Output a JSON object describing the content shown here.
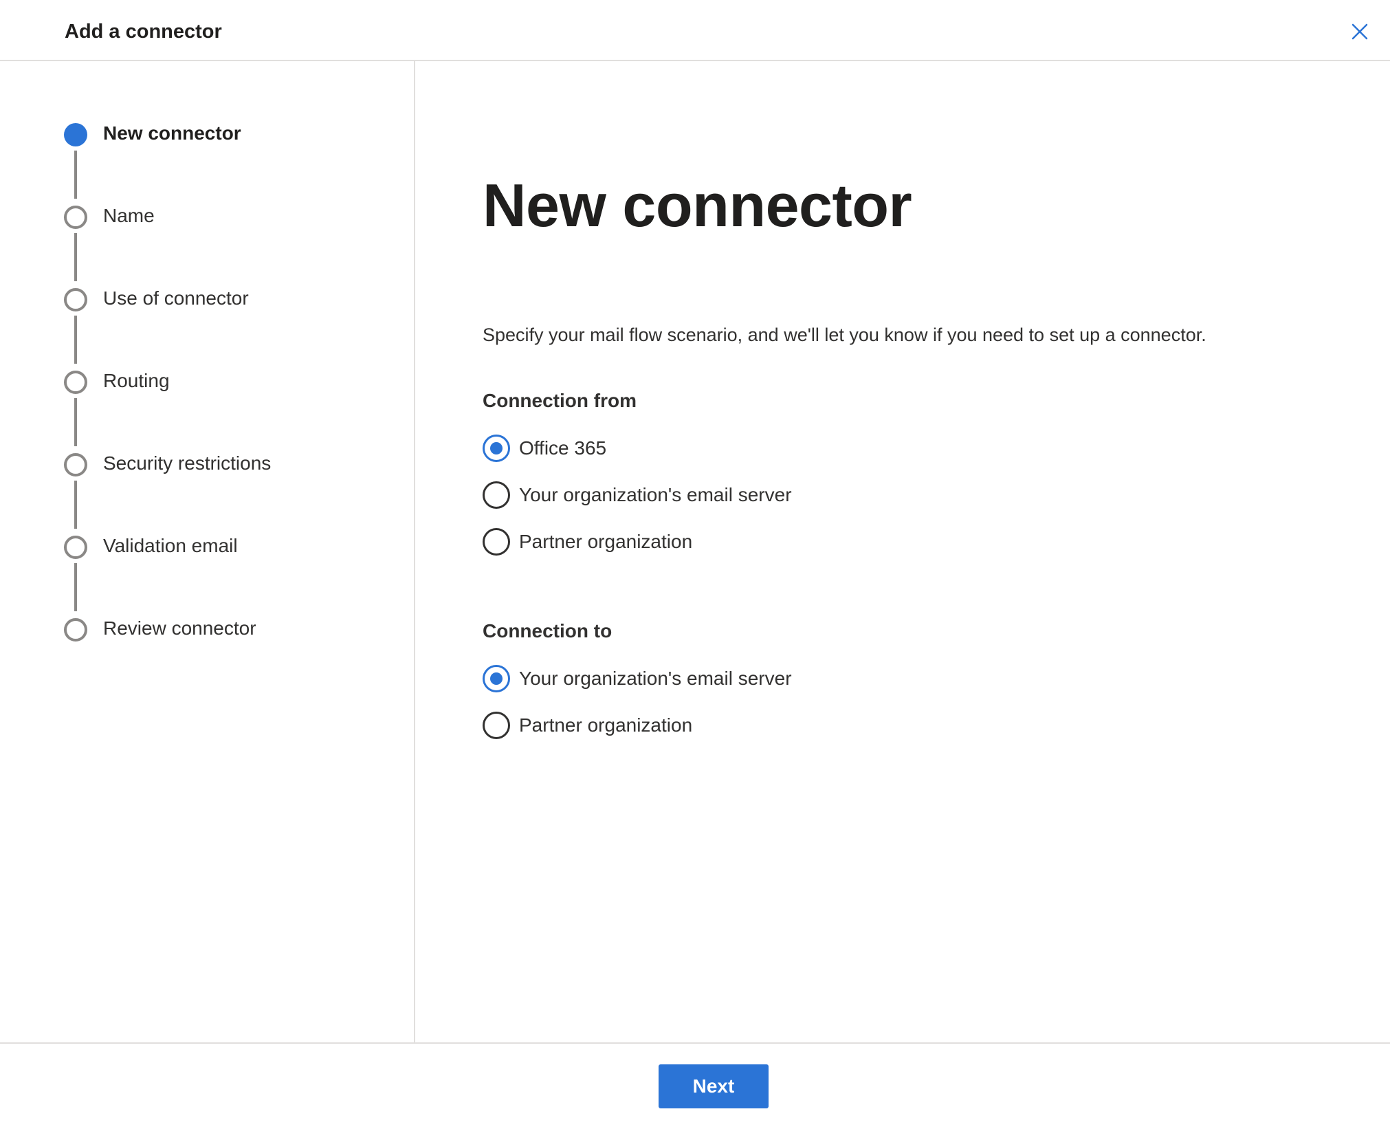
{
  "header": {
    "title": "Add a connector",
    "close_icon": "close-icon"
  },
  "steps": [
    {
      "label": "New connector",
      "state": "current"
    },
    {
      "label": "Name",
      "state": "pending"
    },
    {
      "label": "Use of connector",
      "state": "pending"
    },
    {
      "label": "Routing",
      "state": "pending"
    },
    {
      "label": "Security restrictions",
      "state": "pending"
    },
    {
      "label": "Validation email",
      "state": "pending"
    },
    {
      "label": "Review connector",
      "state": "pending"
    }
  ],
  "main": {
    "title": "New connector",
    "description": "Specify your mail flow scenario, and we'll let you know if you need to set up a connector.",
    "connection_from": {
      "label": "Connection from",
      "options": [
        {
          "label": "Office 365",
          "checked": true
        },
        {
          "label": "Your organization's email server",
          "checked": false
        },
        {
          "label": "Partner organization",
          "checked": false
        }
      ]
    },
    "connection_to": {
      "label": "Connection to",
      "options": [
        {
          "label": "Your organization's email server",
          "checked": true
        },
        {
          "label": "Partner organization",
          "checked": false
        }
      ]
    }
  },
  "footer": {
    "next_label": "Next"
  },
  "colors": {
    "accent": "#2b74d6",
    "text": "#323130",
    "divider": "#e1dfdd",
    "step_inactive": "#8a8886"
  }
}
